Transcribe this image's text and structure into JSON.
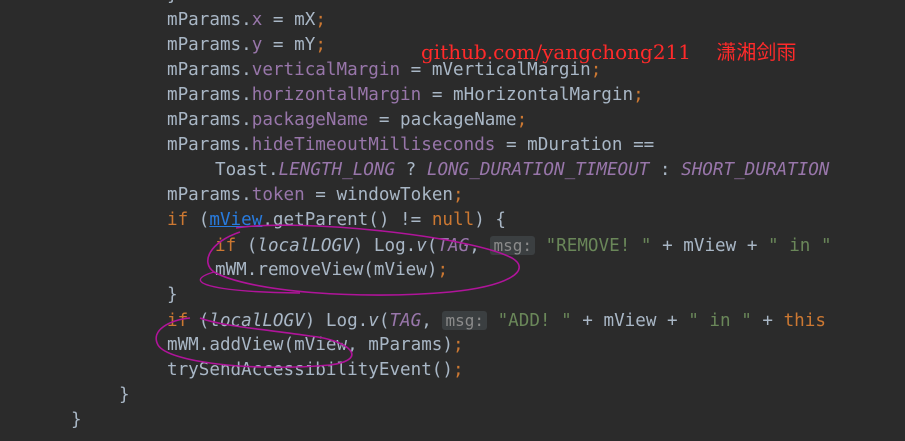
{
  "watermark": {
    "text": "github.com/yangchong211    潇湘剑雨",
    "color": "#ff2a2a"
  },
  "theme": {
    "background": "#2b2b2b",
    "text": "#a9b7c6",
    "keyword": "#cc7832",
    "field": "#9876aa",
    "string": "#6a8759",
    "link": "#287bde",
    "annotation_ink": "#b0149a"
  },
  "code_lines": [
    [
      {
        "t": "}",
        "c": ""
      }
    ],
    [
      {
        "t": "mParams.",
        "c": ""
      },
      {
        "t": "x",
        "c": "f"
      },
      {
        "t": " = mX",
        "c": ""
      },
      {
        "t": ";",
        "c": "k"
      }
    ],
    [
      {
        "t": "mParams.",
        "c": ""
      },
      {
        "t": "y",
        "c": "f"
      },
      {
        "t": " = mY",
        "c": ""
      },
      {
        "t": ";",
        "c": "k"
      }
    ],
    [
      {
        "t": "mParams.",
        "c": ""
      },
      {
        "t": "verticalMargin",
        "c": "f"
      },
      {
        "t": " = mVerticalMargin",
        "c": ""
      },
      {
        "t": ";",
        "c": "k"
      }
    ],
    [
      {
        "t": "mParams.",
        "c": ""
      },
      {
        "t": "horizontalMargin",
        "c": "f"
      },
      {
        "t": " = mHorizontalMargin",
        "c": ""
      },
      {
        "t": ";",
        "c": "k"
      }
    ],
    [
      {
        "t": "mParams.",
        "c": ""
      },
      {
        "t": "packageName",
        "c": "f"
      },
      {
        "t": " = packageName",
        "c": ""
      },
      {
        "t": ";",
        "c": "k"
      }
    ],
    [
      {
        "t": "mParams.",
        "c": ""
      },
      {
        "t": "hideTimeoutMilliseconds",
        "c": "f"
      },
      {
        "t": " = mDuration ==",
        "c": ""
      }
    ],
    [
      {
        "t": "Toast.",
        "c": ""
      },
      {
        "t": "LENGTH_LONG",
        "c": "sf"
      },
      {
        "t": " ? ",
        "c": ""
      },
      {
        "t": "LONG_DURATION_TIMEOUT",
        "c": "sf"
      },
      {
        "t": " : ",
        "c": ""
      },
      {
        "t": "SHORT_DURATION",
        "c": "sf"
      }
    ],
    [
      {
        "t": "mParams.",
        "c": ""
      },
      {
        "t": "token",
        "c": "f"
      },
      {
        "t": " = windowToken",
        "c": ""
      },
      {
        "t": ";",
        "c": "k"
      }
    ],
    [
      {
        "t": "if",
        "c": "k"
      },
      {
        "t": " (",
        "c": ""
      },
      {
        "t": "mView",
        "c": "lnk"
      },
      {
        "t": ".getParent() != ",
        "c": ""
      },
      {
        "t": "null",
        "c": "k"
      },
      {
        "t": ") {",
        "c": ""
      }
    ],
    [
      {
        "t": "if",
        "c": "k"
      },
      {
        "t": " (",
        "c": ""
      },
      {
        "t": "localLOGV",
        "c": "i"
      },
      {
        "t": ") Log.",
        "c": ""
      },
      {
        "t": "v",
        "c": "i"
      },
      {
        "t": "(",
        "c": ""
      },
      {
        "t": "TAG",
        "c": "sf"
      },
      {
        "t": ", ",
        "c": ""
      },
      {
        "t": "msg:",
        "c": "hint"
      },
      {
        "t": " ",
        "c": ""
      },
      {
        "t": "\"REMOVE! \"",
        "c": "s"
      },
      {
        "t": " + mView + ",
        "c": ""
      },
      {
        "t": "\" in \"",
        "c": "s"
      }
    ],
    [
      {
        "t": "mWM.removeView(mView)",
        "c": ""
      },
      {
        "t": ";",
        "c": "k"
      }
    ],
    [
      {
        "t": "}",
        "c": ""
      }
    ],
    [
      {
        "t": "if",
        "c": "k"
      },
      {
        "t": " (",
        "c": ""
      },
      {
        "t": "localLOGV",
        "c": "i"
      },
      {
        "t": ") Log.",
        "c": ""
      },
      {
        "t": "v",
        "c": "i"
      },
      {
        "t": "(",
        "c": ""
      },
      {
        "t": "TAG",
        "c": "sf"
      },
      {
        "t": ", ",
        "c": ""
      },
      {
        "t": "msg:",
        "c": "hint"
      },
      {
        "t": " ",
        "c": ""
      },
      {
        "t": "\"ADD! \"",
        "c": "s"
      },
      {
        "t": " + mView + ",
        "c": ""
      },
      {
        "t": "\" in \"",
        "c": "s"
      },
      {
        "t": " + ",
        "c": ""
      },
      {
        "t": "this",
        "c": "k"
      }
    ],
    [
      {
        "t": "mWM.addView(mView, mParams)",
        "c": ""
      },
      {
        "t": ";",
        "c": "k"
      }
    ],
    [
      {
        "t": "trySendAccessibilityEvent()",
        "c": ""
      },
      {
        "t": ";",
        "c": "k"
      }
    ],
    [
      {
        "t": "}",
        "c": ""
      }
    ],
    [
      {
        "t": "}",
        "c": ""
      }
    ]
  ]
}
